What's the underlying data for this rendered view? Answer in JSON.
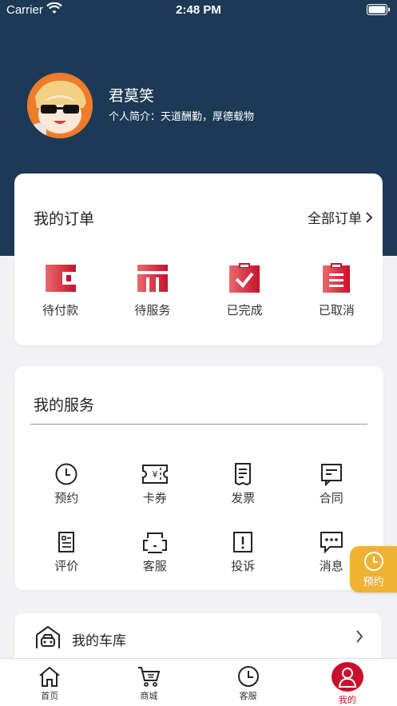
{
  "status_bar": {
    "carrier": "Carrier",
    "time": "2:48 PM"
  },
  "profile": {
    "name": "君莫笑",
    "bio": "个人简介：天道酬勤，厚德载物"
  },
  "orders": {
    "title": "我的订单",
    "all_label": "全部订单",
    "items": [
      {
        "label": "待付款",
        "icon": "wallet-icon"
      },
      {
        "label": "待服务",
        "icon": "service-box-icon"
      },
      {
        "label": "已完成",
        "icon": "clipboard-check-icon"
      },
      {
        "label": "已取消",
        "icon": "clipboard-list-icon"
      }
    ]
  },
  "services": {
    "title": "我的服务",
    "items": [
      {
        "label": "预约",
        "icon": "clock-icon"
      },
      {
        "label": "卡券",
        "icon": "coupon-icon"
      },
      {
        "label": "发票",
        "icon": "invoice-icon"
      },
      {
        "label": "合同",
        "icon": "contract-icon"
      },
      {
        "label": "评价",
        "icon": "review-icon"
      },
      {
        "label": "客服",
        "icon": "customer-service-icon"
      },
      {
        "label": "投诉",
        "icon": "complaint-icon"
      },
      {
        "label": "消息",
        "icon": "message-icon"
      }
    ]
  },
  "garage": {
    "title": "我的车库",
    "icon": "garage-icon"
  },
  "float_button": {
    "label": "预约",
    "icon": "clock-icon"
  },
  "tabbar": {
    "items": [
      {
        "label": "首页",
        "icon": "home-icon"
      },
      {
        "label": "商城",
        "icon": "cart-icon"
      },
      {
        "label": "客服",
        "icon": "clock-icon"
      },
      {
        "label": "我的",
        "icon": "user-icon"
      }
    ],
    "active_index": 3
  },
  "colors": {
    "header": "#1c3a56",
    "accent": "#c8102e",
    "float_button": "#efb232"
  }
}
